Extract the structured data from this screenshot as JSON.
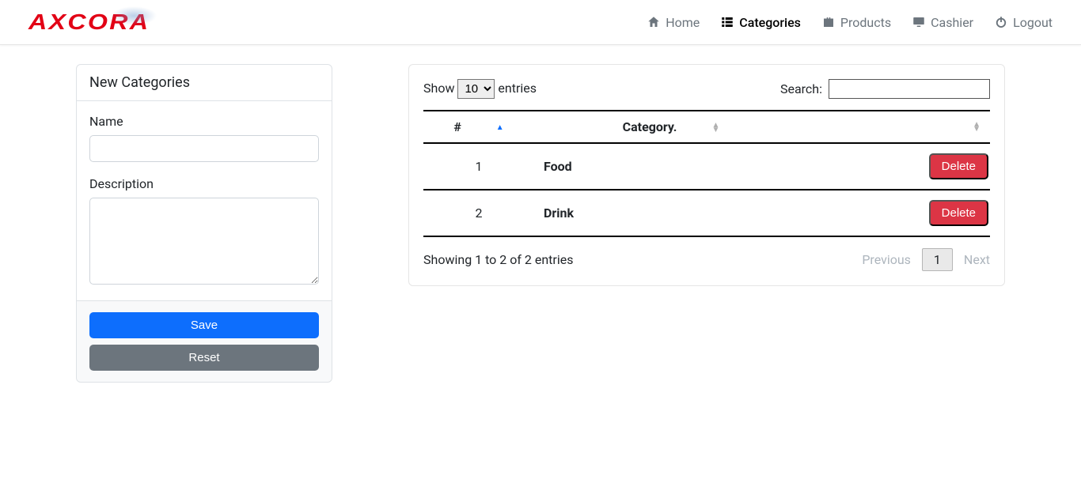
{
  "brand": "AXCORA",
  "nav": {
    "home": "Home",
    "categories": "Categories",
    "products": "Products",
    "cashier": "Cashier",
    "logout": "Logout"
  },
  "form": {
    "title": "New Categories",
    "name_label": "Name",
    "name_value": "",
    "desc_label": "Description",
    "desc_value": "",
    "save": "Save",
    "reset": "Reset"
  },
  "table": {
    "show_prefix": "Show",
    "show_suffix": "entries",
    "length_value": "10",
    "search_label": "Search:",
    "search_value": "",
    "col_num": "#",
    "col_category": "Category.",
    "delete_label": "Delete",
    "rows": [
      {
        "n": "1",
        "name": "Food"
      },
      {
        "n": "2",
        "name": "Drink"
      }
    ],
    "info": "Showing 1 to 2 of 2 entries",
    "prev": "Previous",
    "page": "1",
    "next": "Next"
  }
}
